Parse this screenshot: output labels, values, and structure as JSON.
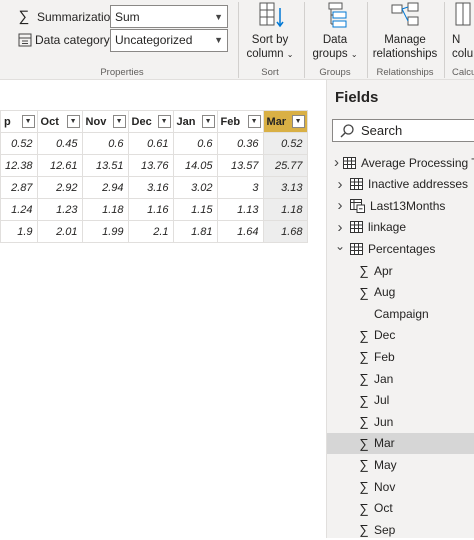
{
  "ribbon": {
    "summarization": {
      "label": "Summarization",
      "value": "Sum"
    },
    "data_category": {
      "label": "Data category",
      "value": "Uncategorized"
    },
    "groups": {
      "properties": "Properties",
      "sort": "Sort",
      "groups": "Groups",
      "relationships": "Relationships",
      "calculations": "Calcula"
    },
    "buttons": {
      "sort_by_column": {
        "line1": "Sort by",
        "line2": "column"
      },
      "data_groups": {
        "line1": "Data",
        "line2": "groups"
      },
      "manage_relationships": {
        "line1": "Manage",
        "line2": "relationships"
      },
      "new_col": {
        "line1": "N",
        "line2": "colu"
      }
    }
  },
  "table": {
    "headers": [
      "p",
      "Oct",
      "Nov",
      "Dec",
      "Jan",
      "Feb",
      "Mar"
    ],
    "rows": [
      [
        "0.52",
        "0.45",
        "0.6",
        "0.61",
        "0.6",
        "0.36",
        "0.52"
      ],
      [
        "12.38",
        "12.61",
        "13.51",
        "13.76",
        "14.05",
        "13.57",
        "25.77"
      ],
      [
        "2.87",
        "2.92",
        "2.94",
        "3.16",
        "3.02",
        "3",
        "3.13"
      ],
      [
        "1.24",
        "1.23",
        "1.18",
        "1.16",
        "1.15",
        "1.13",
        "1.18"
      ],
      [
        "1.9",
        "2.01",
        "1.99",
        "2.1",
        "1.81",
        "1.64",
        "1.68"
      ]
    ]
  },
  "fields": {
    "title": "Fields",
    "search_placeholder": "Search",
    "tables": [
      {
        "name": "Average Processing Tim",
        "expanded": false,
        "icon": "table-icon"
      },
      {
        "name": "Inactive addresses",
        "expanded": false,
        "icon": "table-icon"
      },
      {
        "name": "Last13Months",
        "expanded": false,
        "icon": "calculated-table-icon"
      },
      {
        "name": "linkage",
        "expanded": false,
        "icon": "table-icon"
      },
      {
        "name": "Percentages",
        "expanded": true,
        "icon": "table-icon"
      }
    ],
    "percentages_fields": [
      {
        "name": "Apr",
        "sigma": true
      },
      {
        "name": "Aug",
        "sigma": true
      },
      {
        "name": "Campaign",
        "sigma": false
      },
      {
        "name": "Dec",
        "sigma": true
      },
      {
        "name": "Feb",
        "sigma": true
      },
      {
        "name": "Jan",
        "sigma": true
      },
      {
        "name": "Jul",
        "sigma": true
      },
      {
        "name": "Jun",
        "sigma": true
      },
      {
        "name": "Mar",
        "sigma": true,
        "selected": true
      },
      {
        "name": "May",
        "sigma": true
      },
      {
        "name": "Nov",
        "sigma": true
      },
      {
        "name": "Oct",
        "sigma": true
      },
      {
        "name": "Sep",
        "sigma": true
      }
    ]
  },
  "colors": {
    "active_header": "#d9b045",
    "active_column": "#ededed",
    "ribbon_bg": "#f3f2f1",
    "selected_item": "#d6d6d6"
  }
}
